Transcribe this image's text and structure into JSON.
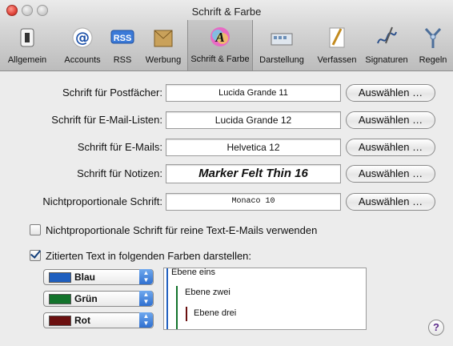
{
  "window": {
    "title": "Schrift & Farbe"
  },
  "toolbar": {
    "items": [
      {
        "label": "Allgemein",
        "icon": "switch-icon"
      },
      {
        "label": "Accounts",
        "icon": "at-sign-icon"
      },
      {
        "label": "RSS",
        "icon": "rss-icon"
      },
      {
        "label": "Werbung",
        "icon": "junk-mail-icon"
      },
      {
        "label": "Schrift & Farbe",
        "icon": "font-color-icon",
        "selected": true
      },
      {
        "label": "Darstellung",
        "icon": "display-icon"
      },
      {
        "label": "Verfassen",
        "icon": "pencil-icon"
      },
      {
        "label": "Signaturen",
        "icon": "signature-icon"
      },
      {
        "label": "Regeln",
        "icon": "rules-icon"
      }
    ]
  },
  "fonts": {
    "rows": [
      {
        "label": "Schrift für Postfächer:",
        "value": "Lucida Grande 11",
        "button": "Auswählen …"
      },
      {
        "label": "Schrift für E-Mail-Listen:",
        "value": "Lucida Grande 12",
        "button": "Auswählen …"
      },
      {
        "label": "Schrift für E-Mails:",
        "value": "Helvetica 12",
        "button": "Auswählen …"
      },
      {
        "label": "Schrift für Notizen:",
        "value": "Marker Felt Thin 16",
        "button": "Auswählen …"
      },
      {
        "label": "Nichtproportionale Schrift:",
        "value": "Monaco 10",
        "button": "Auswählen …"
      }
    ]
  },
  "options": {
    "monospace_plain": {
      "label": "Nichtproportionale Schrift für reine Text-E-Mails verwenden",
      "checked": false
    },
    "quote_colors": {
      "label": "Zitierten Text in folgenden Farben darstellen:",
      "checked": true
    }
  },
  "quote_colors": {
    "popups": [
      {
        "label": "Blau",
        "color": "#1f5fbf"
      },
      {
        "label": "Grün",
        "color": "#13732c"
      },
      {
        "label": "Rot",
        "color": "#6b1010"
      }
    ],
    "preview": [
      "Ebene eins",
      "Ebene zwei",
      "Ebene drei"
    ]
  },
  "help": {
    "label": "?"
  }
}
